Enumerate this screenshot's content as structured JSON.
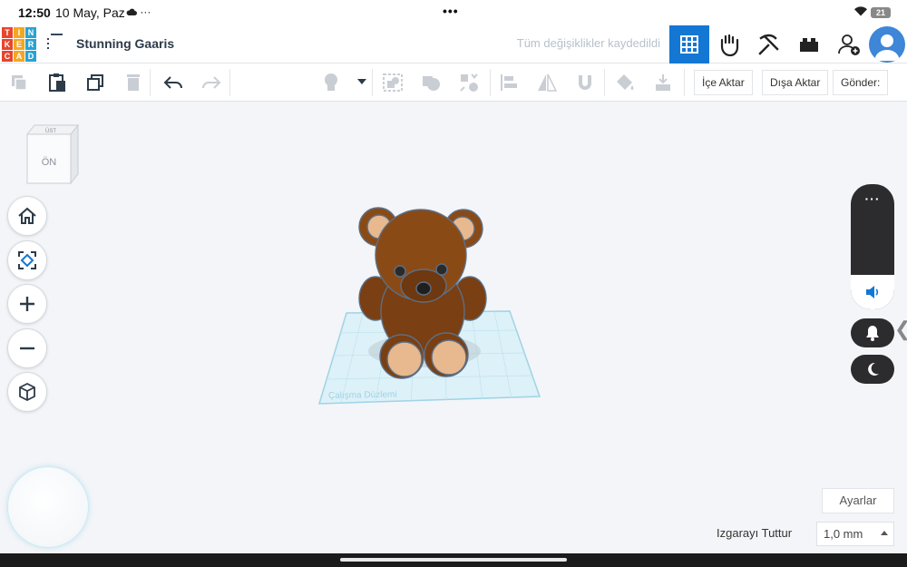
{
  "status_bar": {
    "time": "12:50",
    "date": "10 May, Paz",
    "cloud_icon": "cloud-icon",
    "overflow": "···",
    "center_dots": "•••",
    "battery_level": "21"
  },
  "header": {
    "logo_letters": [
      "T",
      "I",
      "N",
      "K",
      "E",
      "R",
      "C",
      "A",
      "D"
    ],
    "logo_colors": [
      "#e8452c",
      "#f5a623",
      "#27a3d4",
      "#e8452c",
      "#f5a623",
      "#27a3d4",
      "#e8452c",
      "#f5a623",
      "#27a3d4"
    ],
    "project_title": "Stunning Gaaris",
    "save_status": "Tüm değişiklikler kaydedildi",
    "accent_color": "#1477d4"
  },
  "toolbar": {
    "import_label": "İçe Aktar",
    "export_label": "Dışa Aktar",
    "send_label": "Gönder:"
  },
  "view_cube": {
    "top_label": "ÜST",
    "front_label": "ÖN"
  },
  "workplane": {
    "label": "Çalışma Düzlemi"
  },
  "bottom": {
    "settings_label": "Ayarlar",
    "snap_grid_label": "Izgarayı Tuttur",
    "snap_grid_value": "1,0 mm"
  }
}
